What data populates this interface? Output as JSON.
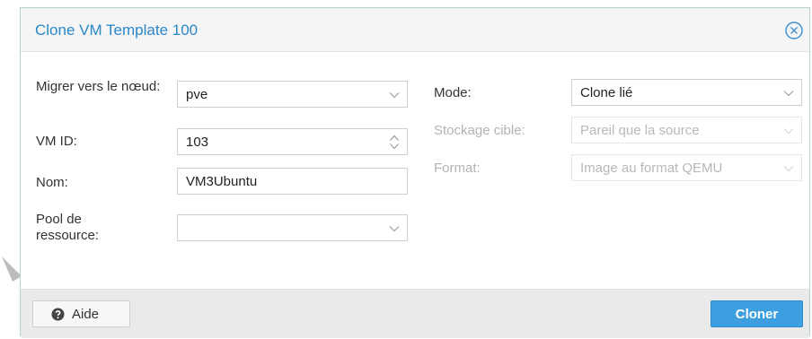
{
  "dialog": {
    "title": "Clone VM Template 100",
    "close_icon": "close-circle-icon"
  },
  "form": {
    "target_node": {
      "label": "Migrer vers le nœud:",
      "value": "pve"
    },
    "vmid": {
      "label": "VM ID:",
      "value": "103"
    },
    "name": {
      "label": "Nom:",
      "value": "VM3Ubuntu"
    },
    "pool": {
      "label": "Pool de ressource:",
      "value": ""
    },
    "mode": {
      "label": "Mode:",
      "value": "Clone lié"
    },
    "target_storage": {
      "label": "Stockage cible:",
      "value": "Pareil que la source",
      "disabled": true
    },
    "format": {
      "label": "Format:",
      "value": "Image au format QEMU",
      "disabled": true
    }
  },
  "footer": {
    "help_label": "Aide",
    "help_icon": "question-circle-icon",
    "clone_label": "Cloner"
  },
  "colors": {
    "title": "#2a87c8",
    "primary_button": "#3d9ee0",
    "disabled_text": "#b3b3b3"
  }
}
